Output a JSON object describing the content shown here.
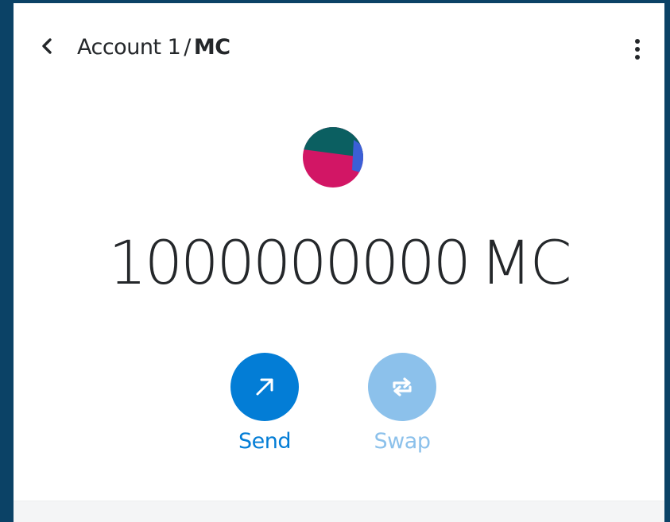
{
  "header": {
    "account_name": "Account 1",
    "separator": "/",
    "token_symbol": "MC"
  },
  "icons": {
    "back": "chevron-left-icon",
    "menu": "vertical-dots-icon",
    "token": "token-identicon",
    "send": "arrow-up-right-icon",
    "swap": "swap-arrows-icon"
  },
  "balance": {
    "amount": "1000000000",
    "symbol": "MC"
  },
  "actions": {
    "send_label": "Send",
    "swap_label": "Swap"
  },
  "colors": {
    "background": "#0b4266",
    "primary": "#037dd6",
    "primary_disabled": "#8cc1eb",
    "text": "#24272a",
    "identicon_teal": "#0b5f61",
    "identicon_pink": "#d21665",
    "identicon_blue": "#3b5fd6"
  }
}
